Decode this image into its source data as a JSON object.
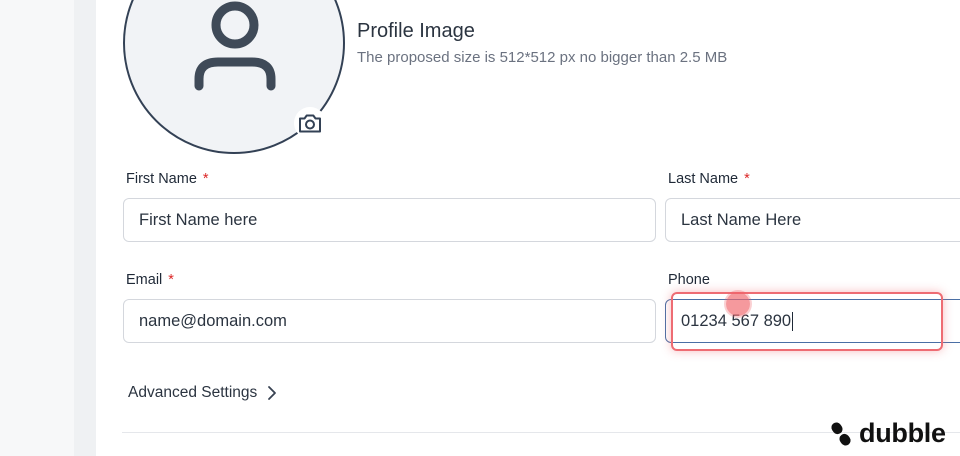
{
  "profile": {
    "title": "Profile Image",
    "subtitle": "The proposed size is 512*512 px no bigger than 2.5 MB"
  },
  "form": {
    "first_name": {
      "label": "First Name",
      "required_mark": "*",
      "placeholder": "First Name here"
    },
    "last_name": {
      "label": "Last Name",
      "required_mark": "*",
      "placeholder": "Last Name Here"
    },
    "email": {
      "label": "Email",
      "required_mark": "*",
      "placeholder": "name@domain.com"
    },
    "phone": {
      "label": "Phone",
      "value": "01234 567 890"
    }
  },
  "advanced": {
    "label": "Advanced Settings"
  },
  "brand": {
    "name": "dubble"
  },
  "icons": {
    "avatar": "user-icon",
    "camera": "camera-icon",
    "chevron": "chevron-right-icon",
    "logo": "dubble-logo-icon"
  },
  "colors": {
    "required": "#dc2626",
    "highlight": "#ee6c73",
    "focus_border": "#4a6fa5"
  }
}
